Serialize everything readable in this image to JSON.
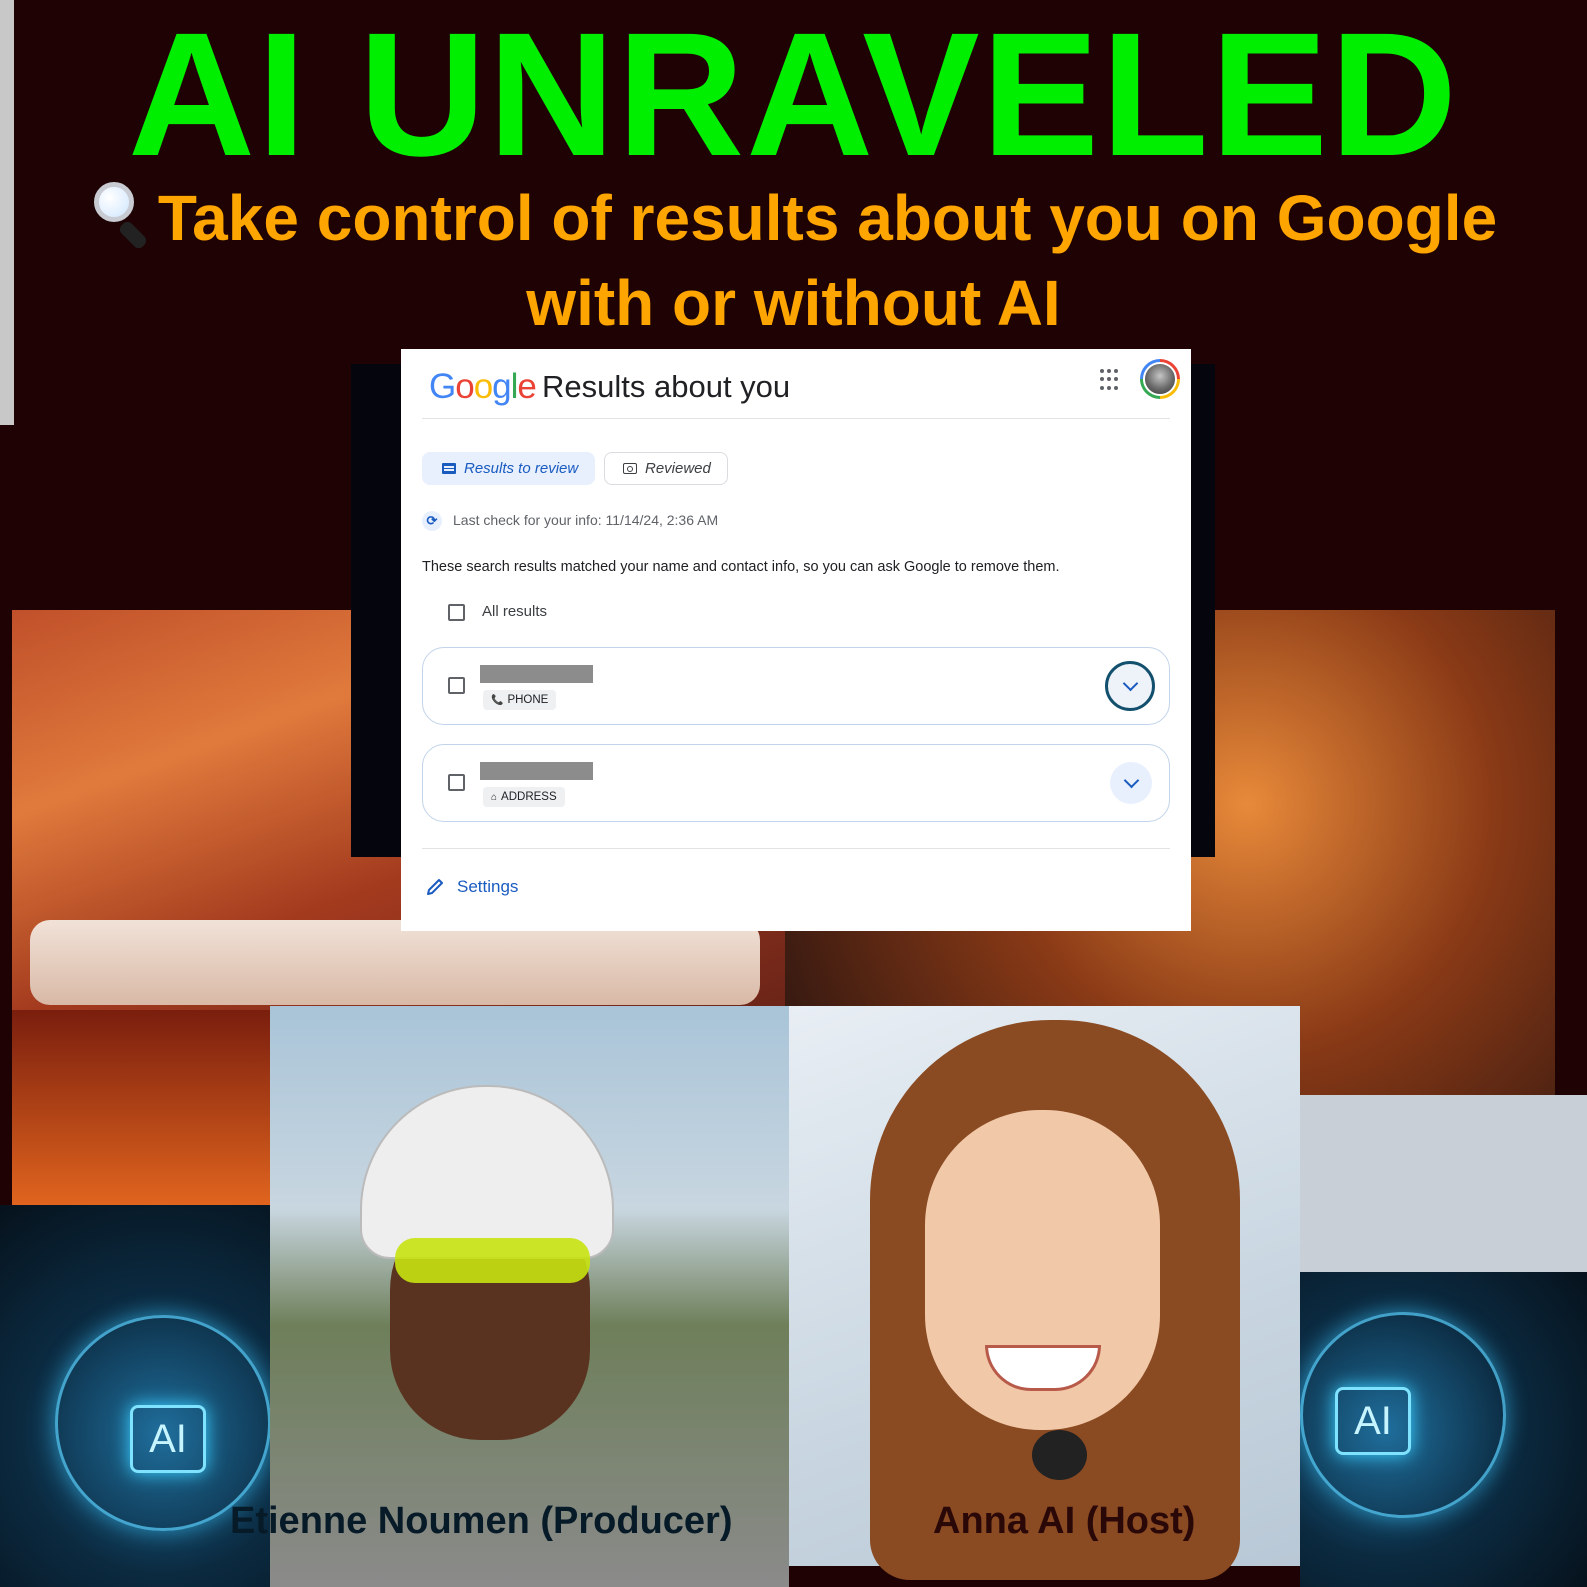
{
  "banner": {
    "title": "AI UNRAVELED",
    "subtitle_icon": "magnifying-glass-icon",
    "subtitle_line1": "Take control of results about you on Google",
    "subtitle_line2": "with or without AI",
    "colors": {
      "title": "#00ef00",
      "subtitle": "#ffa500",
      "background": "#1e0204"
    }
  },
  "google_card": {
    "logo": {
      "letters": [
        "G",
        "o",
        "o",
        "g",
        "l",
        "e"
      ],
      "colors": [
        "#4285f4",
        "#ea4335",
        "#fbbc05",
        "#4285f4",
        "#34a853",
        "#ea4335"
      ]
    },
    "title": "Results about you",
    "header_icons": [
      "apps-grid-icon",
      "account-avatar"
    ],
    "tabs": [
      {
        "label": "Results to review",
        "icon": "list-icon",
        "active": true
      },
      {
        "label": "Reviewed",
        "icon": "reviewed-icon",
        "active": false
      }
    ],
    "last_check_icon": "sync-icon",
    "last_check": "Last check for your info: 11/14/24, 2:36 AM",
    "description": "These search results matched your name and contact info, so you can ask Google to remove them.",
    "select_all_label": "All results",
    "results": [
      {
        "type_label": "PHONE",
        "type_icon": "phone-icon",
        "icon_glyph": "📞",
        "checked": false,
        "redacted": true
      },
      {
        "type_label": "ADDRESS",
        "type_icon": "home-icon",
        "icon_glyph": "⌂",
        "checked": false,
        "redacted": true
      }
    ],
    "settings_label": "Settings",
    "accent": "#1a5bc0"
  },
  "captions": {
    "producer": "Etienne Noumen (Producer)",
    "host": "Anna AI (Host)"
  },
  "ai_badges": {
    "left": "AI",
    "right": "AI"
  },
  "sync_glyph": "⟳"
}
